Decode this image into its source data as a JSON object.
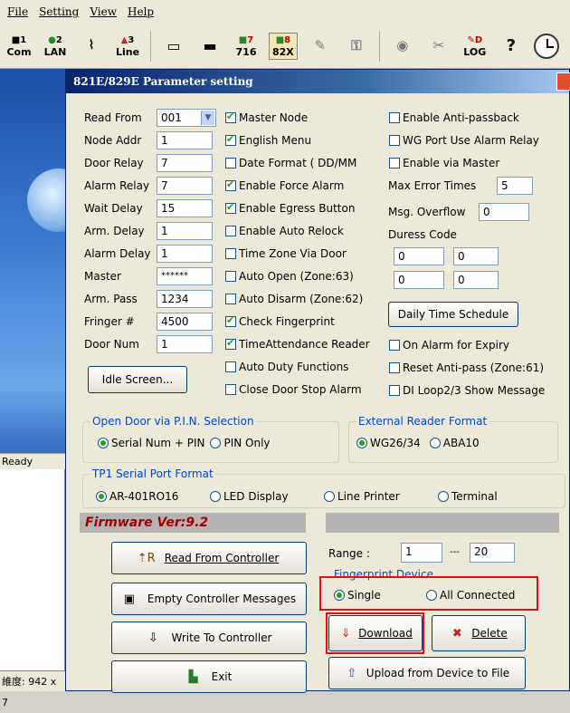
{
  "menu": [
    "File",
    "Setting",
    "View",
    "Help"
  ],
  "toolbar": {
    "com_num": "1",
    "com_label": "Com",
    "lan_num": "2",
    "lan_label": "LAN",
    "line_num": "3",
    "line_label": "Line",
    "t716_num": "7",
    "t716_label": "716",
    "t82_num": "8",
    "t82_label": "82X",
    "log_label": "LOG",
    "log_letter": "D"
  },
  "left": {
    "ready": "Ready",
    "status": "維度: 942 x 7"
  },
  "dialog": {
    "title": "821E/829E Parameter setting",
    "fields": {
      "read_from_label": "Read From",
      "read_from": "001",
      "node_addr_label": "Node Addr",
      "node_addr": "1",
      "door_relay_label": "Door Relay",
      "door_relay": "7",
      "alarm_relay_label": "Alarm Relay",
      "alarm_relay": "7",
      "wait_delay_label": "Wait Delay",
      "wait_delay": "15",
      "arm_delay_label": "Arm. Delay",
      "arm_delay": "1",
      "alarm_delay_label": "Alarm Delay",
      "alarm_delay": "1",
      "master_label": "Master",
      "master": "******",
      "arm_pass_label": "Arm. Pass",
      "arm_pass": "1234",
      "finger_label": "Fringer #",
      "finger": "4500",
      "door_num_label": "Door Num",
      "door_num": "1"
    },
    "checks_mid": [
      {
        "label": "Master Node",
        "on": true
      },
      {
        "label": "English Menu",
        "on": true
      },
      {
        "label": "Date Format ( DD/MM",
        "on": false
      },
      {
        "label": "Enable Force Alarm",
        "on": true
      },
      {
        "label": "Enable Egress Button",
        "on": true
      },
      {
        "label": "Enable Auto Relock",
        "on": false
      },
      {
        "label": "Time Zone Via Door",
        "on": false
      },
      {
        "label": "Auto Open (Zone:63)",
        "on": false
      },
      {
        "label": "Auto Disarm (Zone:62)",
        "on": false
      },
      {
        "label": "Check Fingerprint",
        "on": true
      },
      {
        "label": "TimeAttendance Reader",
        "on": true
      },
      {
        "label": "Auto Duty Functions",
        "on": false
      },
      {
        "label": "Close Door Stop Alarm",
        "on": false
      }
    ],
    "checks_right_top": [
      {
        "label": "Enable Anti-passback",
        "on": false
      },
      {
        "label": "WG Port Use Alarm Relay",
        "on": false
      },
      {
        "label": "Enable via Master",
        "on": false
      }
    ],
    "max_error_label": "Max Error Times",
    "max_error": "5",
    "msg_overflow_label": "Msg. Overflow",
    "msg_overflow": "0",
    "duress_label": "Duress Code",
    "duress": [
      "0",
      "0",
      "0",
      "0"
    ],
    "daily_schedule": "Daily Time Schedule",
    "checks_right_bottom": [
      {
        "label": "On Alarm for Expiry",
        "on": false
      },
      {
        "label": "Reset Anti-pass (Zone:61)",
        "on": false
      },
      {
        "label": "DI Loop2/3 Show Message",
        "on": false
      }
    ],
    "idle_screen": "Idle Screen...",
    "pin_group": {
      "title": "Open Door via P.I.N. Selection",
      "opt1": "Serial Num + PIN",
      "opt2": "PIN Only"
    },
    "reader_group": {
      "title": "External Reader Format",
      "opt1": "WG26/34",
      "opt2": "ABA10"
    },
    "tp1_group": {
      "title": "TP1 Serial Port Format",
      "opts": [
        "AR-401RO16",
        "LED Display",
        "Line Printer",
        "Terminal"
      ]
    },
    "firmware": "Firmware Ver:9.2",
    "range_label": "Range :",
    "range_from": "1",
    "range_sep": "---",
    "range_to": "20",
    "fp_device_label": "Fingerprint Device",
    "fp_single": "Single",
    "fp_all": "All Connected",
    "btn_read": "Read From Controller",
    "btn_empty": "Empty Controller Messages",
    "btn_write": "Write To Controller",
    "btn_exit": "Exit",
    "btn_download": "Download",
    "btn_delete": "Delete",
    "btn_upload": "Upload from Device to File"
  }
}
